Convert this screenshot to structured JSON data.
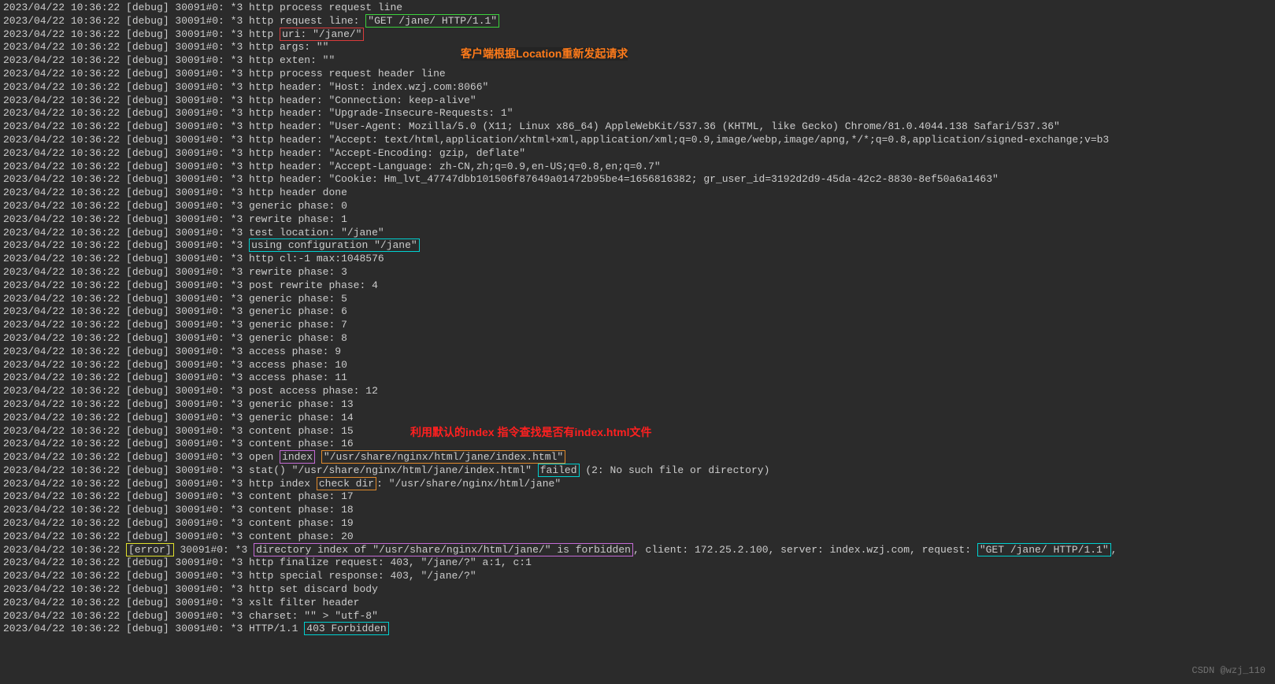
{
  "annotations": {
    "a1": "客户端根据Location重新发起请求",
    "a2": "利用默认的index 指令查找是否有index.html文件"
  },
  "watermark": "CSDN @wzj_110",
  "lines": [
    {
      "pre": "2023/04/22 10:36:22 [debug] 30091#0: *3 http process request line"
    },
    {
      "pre": "2023/04/22 10:36:22 [debug] 30091#0: *3 http request line: ",
      "hl": "\"GET /jane/ HTTP/1.1\"",
      "cl": "box-green"
    },
    {
      "pre": "2023/04/22 10:36:22 [debug] 30091#0: *3 http ",
      "hl": "uri: \"/jane/\"",
      "cl": "box-red"
    },
    {
      "pre": "2023/04/22 10:36:22 [debug] 30091#0: *3 http args: \"\""
    },
    {
      "pre": "2023/04/22 10:36:22 [debug] 30091#0: *3 http exten: \"\""
    },
    {
      "pre": "2023/04/22 10:36:22 [debug] 30091#0: *3 http process request header line"
    },
    {
      "pre": "2023/04/22 10:36:22 [debug] 30091#0: *3 http header: \"Host: index.wzj.com:8066\""
    },
    {
      "pre": "2023/04/22 10:36:22 [debug] 30091#0: *3 http header: \"Connection: keep-alive\""
    },
    {
      "pre": "2023/04/22 10:36:22 [debug] 30091#0: *3 http header: \"Upgrade-Insecure-Requests: 1\""
    },
    {
      "pre": "2023/04/22 10:36:22 [debug] 30091#0: *3 http header: \"User-Agent: Mozilla/5.0 (X11; Linux x86_64) AppleWebKit/537.36 (KHTML, like Gecko) Chrome/81.0.4044.138 Safari/537.36\""
    },
    {
      "pre": "2023/04/22 10:36:22 [debug] 30091#0: *3 http header: \"Accept: text/html,application/xhtml+xml,application/xml;q=0.9,image/webp,image/apng,*/*;q=0.8,application/signed-exchange;v=b3"
    },
    {
      "pre": "2023/04/22 10:36:22 [debug] 30091#0: *3 http header: \"Accept-Encoding: gzip, deflate\""
    },
    {
      "pre": "2023/04/22 10:36:22 [debug] 30091#0: *3 http header: \"Accept-Language: zh-CN,zh;q=0.9,en-US;q=0.8,en;q=0.7\""
    },
    {
      "pre": "2023/04/22 10:36:22 [debug] 30091#0: *3 http header: \"Cookie: Hm_lvt_47747dbb101506f87649a01472b95be4=1656816382; gr_user_id=3192d2d9-45da-42c2-8830-8ef50a6a1463\""
    },
    {
      "pre": "2023/04/22 10:36:22 [debug] 30091#0: *3 http header done"
    },
    {
      "pre": "2023/04/22 10:36:22 [debug] 30091#0: *3 generic phase: 0"
    },
    {
      "pre": "2023/04/22 10:36:22 [debug] 30091#0: *3 rewrite phase: 1"
    },
    {
      "pre": "2023/04/22 10:36:22 [debug] 30091#0: *3 test location: \"/jane\""
    },
    {
      "pre": "2023/04/22 10:36:22 [debug] 30091#0: *3 ",
      "hl": "using configuration \"/jane\"",
      "cl": "box-cyan"
    },
    {
      "pre": "2023/04/22 10:36:22 [debug] 30091#0: *3 http cl:-1 max:1048576"
    },
    {
      "pre": "2023/04/22 10:36:22 [debug] 30091#0: *3 rewrite phase: 3"
    },
    {
      "pre": "2023/04/22 10:36:22 [debug] 30091#0: *3 post rewrite phase: 4"
    },
    {
      "pre": "2023/04/22 10:36:22 [debug] 30091#0: *3 generic phase: 5"
    },
    {
      "pre": "2023/04/22 10:36:22 [debug] 30091#0: *3 generic phase: 6"
    },
    {
      "pre": "2023/04/22 10:36:22 [debug] 30091#0: *3 generic phase: 7"
    },
    {
      "pre": "2023/04/22 10:36:22 [debug] 30091#0: *3 generic phase: 8"
    },
    {
      "pre": "2023/04/22 10:36:22 [debug] 30091#0: *3 access phase: 9"
    },
    {
      "pre": "2023/04/22 10:36:22 [debug] 30091#0: *3 access phase: 10"
    },
    {
      "pre": "2023/04/22 10:36:22 [debug] 30091#0: *3 access phase: 11"
    },
    {
      "pre": "2023/04/22 10:36:22 [debug] 30091#0: *3 post access phase: 12"
    },
    {
      "pre": "2023/04/22 10:36:22 [debug] 30091#0: *3 generic phase: 13"
    },
    {
      "pre": "2023/04/22 10:36:22 [debug] 30091#0: *3 generic phase: 14"
    },
    {
      "pre": "2023/04/22 10:36:22 [debug] 30091#0: *3 content phase: 15"
    },
    {
      "pre": "2023/04/22 10:36:22 [debug] 30091#0: *3 content phase: 16"
    },
    {
      "pre": "2023/04/22 10:36:22 [debug] 30091#0: *3 open ",
      "hl": "index",
      "cl": "box-purple",
      "mid": " ",
      "hl2": "\"/usr/share/nginx/html/jane/index.html\"",
      "cl2": "box-orange"
    },
    {
      "pre": "2023/04/22 10:36:22 [debug] 30091#0: *3 stat() \"/usr/share/nginx/html/jane/index.html\" ",
      "hl": "failed",
      "cl": "box-cyan",
      "post": " (2: No such file or directory)"
    },
    {
      "pre": "2023/04/22 10:36:22 [debug] 30091#0: *3 http index ",
      "hl": "check dir",
      "cl": "box-orange",
      "post": ": \"/usr/share/nginx/html/jane\""
    },
    {
      "pre": "2023/04/22 10:36:22 [debug] 30091#0: *3 content phase: 17"
    },
    {
      "pre": "2023/04/22 10:36:22 [debug] 30091#0: *3 content phase: 18"
    },
    {
      "pre": "2023/04/22 10:36:22 [debug] 30091#0: *3 content phase: 19"
    },
    {
      "pre": "2023/04/22 10:36:22 [debug] 30091#0: *3 content phase: 20"
    },
    {
      "pre": "2023/04/22 10:36:22 ",
      "hl": "[error]",
      "cl": "box-yellow",
      "mid": " 30091#0: *3 ",
      "hl2": "directory index of \"/usr/share/nginx/html/jane/\" is forbidden",
      "cl2": "box-purple",
      "post": ", client: 172.25.2.100, server: index.wzj.com, request: ",
      "hl3": "\"GET /jane/ HTTP/1.1\"",
      "cl3": "box-cyan",
      "tail": ","
    },
    {
      "pre": "2023/04/22 10:36:22 [debug] 30091#0: *3 http finalize request: 403, \"/jane/?\" a:1, c:1"
    },
    {
      "pre": "2023/04/22 10:36:22 [debug] 30091#0: *3 http special response: 403, \"/jane/?\""
    },
    {
      "pre": "2023/04/22 10:36:22 [debug] 30091#0: *3 http set discard body"
    },
    {
      "pre": "2023/04/22 10:36:22 [debug] 30091#0: *3 xslt filter header"
    },
    {
      "pre": "2023/04/22 10:36:22 [debug] 30091#0: *3 charset: \"\" > \"utf-8\""
    },
    {
      "pre": "2023/04/22 10:36:22 [debug] 30091#0: *3 HTTP/1.1 ",
      "hl": "403 Forbidden",
      "cl": "box-cyan"
    }
  ]
}
